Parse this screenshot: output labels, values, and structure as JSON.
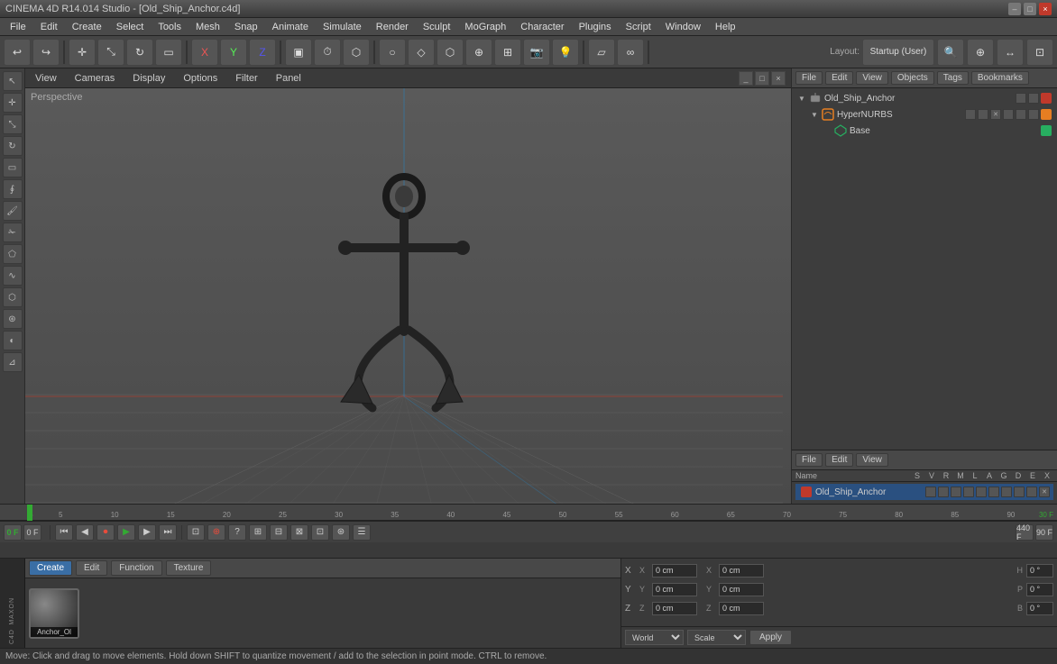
{
  "app": {
    "title": "CINEMA 4D R14.014 Studio - [Old_Ship_Anchor.c4d]",
    "window_controls": [
      "–",
      "□",
      "×"
    ]
  },
  "menu_bar": {
    "items": [
      "File",
      "Edit",
      "Create",
      "Select",
      "Tools",
      "Mesh",
      "Snap",
      "Animate",
      "Simulate",
      "Render",
      "Sculpt",
      "MoGraph",
      "Character",
      "Plugins",
      "Script",
      "Window",
      "Help"
    ]
  },
  "right_panel": {
    "toolbar_buttons": [
      "File",
      "Edit",
      "View",
      "Objects",
      "Tags",
      "Bookmarks"
    ],
    "objects": [
      {
        "name": "Old_Ship_Anchor",
        "type": "null",
        "level": 0,
        "color": "#c0392b"
      },
      {
        "name": "HyperNURBS",
        "type": "hypernurbs",
        "level": 1,
        "color": "#e67e22"
      },
      {
        "name": "Base",
        "type": "mesh",
        "level": 2,
        "color": "#27ae60"
      }
    ]
  },
  "right_panel_lower": {
    "toolbar_buttons": [
      "File",
      "Edit",
      "View"
    ],
    "column_headers": [
      "Name",
      "S",
      "V",
      "R",
      "M",
      "L",
      "A",
      "G",
      "D",
      "E",
      "X"
    ],
    "object": {
      "name": "Old_Ship_Anchor",
      "color": "#c0392b"
    }
  },
  "viewport": {
    "label": "Perspective",
    "menu_items": [
      "View",
      "Cameras",
      "Display",
      "Options",
      "Filter",
      "Panel"
    ]
  },
  "timeline": {
    "markers": [
      "0",
      "5",
      "10",
      "15",
      "20",
      "25",
      "30",
      "35",
      "40",
      "45",
      "50",
      "55",
      "60",
      "65",
      "70",
      "75",
      "80",
      "85",
      "90"
    ],
    "end_frame": "90 F",
    "current_frame": "0 F",
    "fps": "30 F",
    "start_display": "0 F",
    "end_display": "90 F"
  },
  "playback": {
    "current_time": "0 F",
    "min_time": "0 F",
    "max_time": "90 F",
    "fps": "30 F"
  },
  "bottom_toolbar": {
    "tabs": [
      "Create",
      "Edit",
      "Function",
      "Texture"
    ]
  },
  "material": {
    "name": "Anchor_Ol"
  },
  "coordinates": {
    "x_pos": "0 cm",
    "y_pos": "0 cm",
    "z_pos": "0 cm",
    "x_size": "0 cm",
    "y_size": "0 cm",
    "z_size": "0 cm",
    "h": "0 °",
    "p": "0 °",
    "b": "0 °",
    "mode_world": "World",
    "mode_scale": "Scale",
    "apply_label": "Apply"
  },
  "status_bar": {
    "message": "Move: Click and drag to move elements. Hold down SHIFT to quantize movement / add to the selection in point mode. CTRL to remove."
  },
  "icons": {
    "undo": "↩",
    "redo": "↪",
    "new": "📄",
    "open": "📂",
    "save": "💾",
    "play": "▶",
    "pause": "⏸",
    "stop": "⏹",
    "rewind": "⏮",
    "fast_forward": "⏭",
    "prev_frame": "◀",
    "next_frame": "▶",
    "record": "⏺",
    "loop": "🔁",
    "arrow": "↖",
    "move": "✛",
    "scale": "⤡",
    "rotate": "↻",
    "select": "▭",
    "expand": "▶",
    "collapse": "▼",
    "anchor": "⚓"
  }
}
